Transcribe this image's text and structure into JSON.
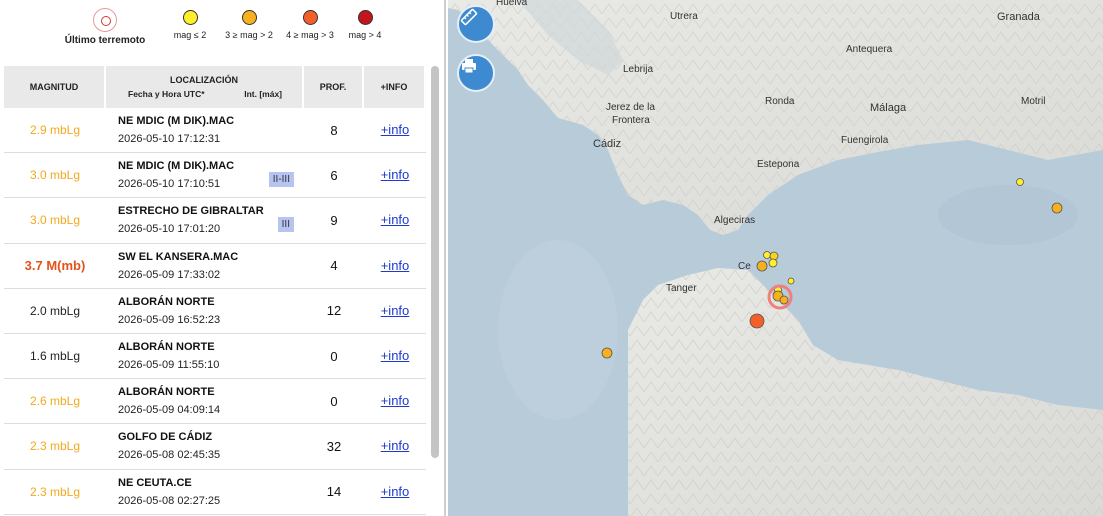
{
  "legend": {
    "last_quake": "Último terremoto",
    "items": [
      {
        "label": "mag ≤ 2",
        "color": "#ffee2a"
      },
      {
        "label": "3 ≥ mag > 2",
        "color": "#f7b11e"
      },
      {
        "label": "4 ≥ mag > 3",
        "color": "#f2602a"
      },
      {
        "label": "mag > 4",
        "color": "#c4141c"
      }
    ]
  },
  "table": {
    "col_magnitude": "MAGNITUD",
    "col_location": "LOCALIZACIÓN",
    "col_datetime": "Fecha y Hora UTC*",
    "col_intensity": "Int. [máx]",
    "col_depth": "PROF.",
    "col_info": "+INFO",
    "rows": [
      {
        "magnitude": "2.9 mbLg",
        "mag_class": "yellowish",
        "place": "NE MDIC (M DIK).MAC",
        "datetime": "2026-05-10 17:12:31",
        "intensity": "",
        "depth": "8",
        "info": "+info"
      },
      {
        "magnitude": "3.0 mbLg",
        "mag_class": "yellowish",
        "place": "NE MDIC (M DIK).MAC",
        "datetime": "2026-05-10 17:10:51",
        "intensity": "II-III",
        "depth": "6",
        "info": "+info"
      },
      {
        "magnitude": "3.0 mbLg",
        "mag_class": "yellowish",
        "place": "ESTRECHO DE GIBRALTAR",
        "datetime": "2026-05-10 17:01:20",
        "intensity": "III",
        "depth": "9",
        "info": "+info"
      },
      {
        "magnitude": "3.7 M(mb)",
        "mag_class": "orange",
        "place": "SW EL KANSERA.MAC",
        "datetime": "2026-05-09 17:33:02",
        "intensity": "",
        "depth": "4",
        "info": "+info"
      },
      {
        "magnitude": "2.0 mbLg",
        "mag_class": "plain",
        "place": "ALBORÁN NORTE",
        "datetime": "2026-05-09 16:52:23",
        "intensity": "",
        "depth": "12",
        "info": "+info"
      },
      {
        "magnitude": "1.6 mbLg",
        "mag_class": "plain",
        "place": "ALBORÁN NORTE",
        "datetime": "2026-05-09 11:55:10",
        "intensity": "",
        "depth": "0",
        "info": "+info"
      },
      {
        "magnitude": "2.6 mbLg",
        "mag_class": "yellowish",
        "place": "ALBORÁN NORTE",
        "datetime": "2026-05-09 04:09:14",
        "intensity": "",
        "depth": "0",
        "info": "+info"
      },
      {
        "magnitude": "2.3 mbLg",
        "mag_class": "yellowish",
        "place": "GOLFO DE CÁDIZ",
        "datetime": "2026-05-08 02:45:35",
        "intensity": "",
        "depth": "32",
        "info": "+info"
      },
      {
        "magnitude": "2.3 mbLg",
        "mag_class": "yellowish",
        "place": "NE CEUTA.CE",
        "datetime": "2026-05-08 02:27:25",
        "intensity": "",
        "depth": "14",
        "info": "+info"
      }
    ]
  },
  "map": {
    "places": [
      "Huelva",
      "Utrera",
      "Granada",
      "Antequera",
      "Lebrija",
      "Jerez de la",
      "Frontera",
      "Ronda",
      "Málaga",
      "Motril",
      "Cádiz",
      "Fuengirola",
      "Estepona",
      "Algeciras",
      "Ce",
      "Tanger"
    ],
    "buttons": {
      "measure": "ruler-icon",
      "print": "printer-icon"
    }
  }
}
